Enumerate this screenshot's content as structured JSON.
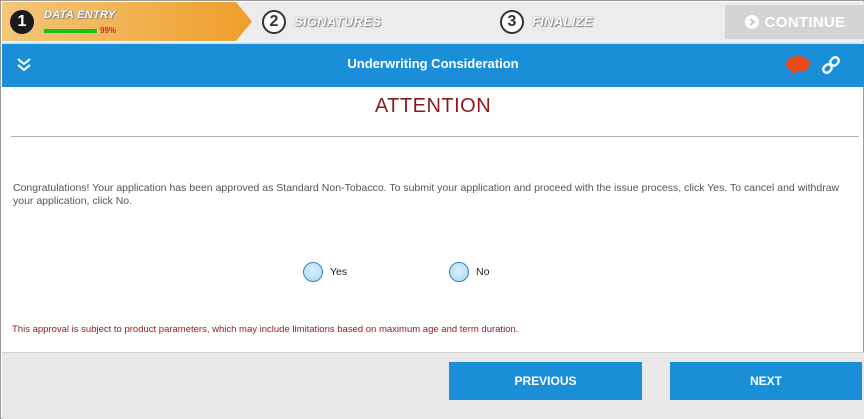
{
  "steps": [
    {
      "number": "1",
      "label": "DATA ENTRY",
      "progress_pct_text": "99%",
      "progress": 0.99
    },
    {
      "number": "2",
      "label": "SIGNATURES"
    },
    {
      "number": "3",
      "label": "FINALIZE"
    }
  ],
  "continue_label": "CONTINUE",
  "header": {
    "title": "Underwriting Consideration",
    "icons": [
      "double-chevron-down-icon",
      "chat-bubble-icon",
      "link-icon"
    ]
  },
  "attention_title": "ATTENTION",
  "message": "Congratulations! Your application has been approved as Standard Non-Tobacco. To submit your application and proceed with the issue process, click Yes.  To cancel and withdraw your application, click No.",
  "options": [
    {
      "label": "Yes",
      "selected": false
    },
    {
      "label": "No",
      "selected": false
    }
  ],
  "disclaimer": "This approval is subject to product parameters, which may include limitations based on maximum age and term duration.",
  "footer": {
    "previous_label": "PREVIOUS",
    "next_label": "NEXT"
  },
  "colors": {
    "header_blue": "#1a8fd8",
    "step_orange": "#ee9e2a",
    "progress_green": "#19c219",
    "attention_red": "#8b1c1c",
    "chat_icon_orange": "#e8491d"
  }
}
